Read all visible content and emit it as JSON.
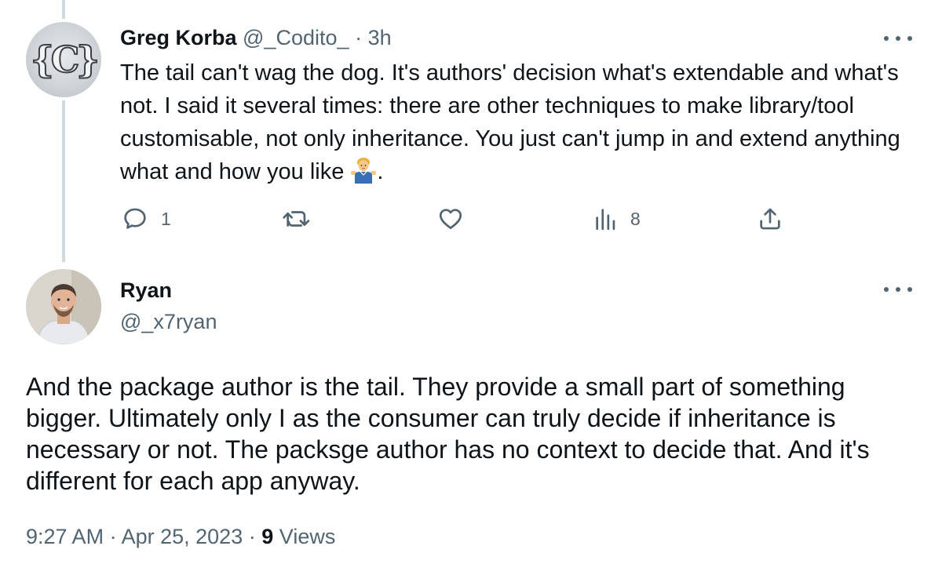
{
  "tweets": [
    {
      "author_name": "Greg Korba",
      "handle": "@_Codito_",
      "separator": "·",
      "time_ago": "3h",
      "avatar_text": "{C}",
      "text": "The tail can't wag the dog. It's authors' decision what's extendable and what's not. I said it several times: there are other techniques to make library/tool customisable, not only inheritance. You just can't jump in and extend anything what and how you like",
      "text_end": ".",
      "emoji": "man-shrugging-emoji",
      "actions": {
        "reply_count": "1",
        "retweet_count": "",
        "like_count": "",
        "views_count": "8"
      }
    },
    {
      "author_name": "Ryan",
      "handle": "@_x7ryan",
      "text": "And the package author is the tail. They provide a small part of something bigger. Ultimately only I as the consumer can truly decide if inheritance is necessary or not. The packsge author has no context to decide that. And it's different for each app anyway.",
      "time": "9:27 AM",
      "separator": "·",
      "date": "Apr 25, 2023",
      "views_count": "9",
      "views_label": "Views"
    }
  ],
  "icons": {
    "reply": "reply-icon",
    "retweet": "retweet-icon",
    "like": "heart-icon",
    "views": "views-chart-icon",
    "share": "share-icon",
    "more": "more-icon"
  },
  "colors": {
    "text_primary": "#0f1419",
    "text_secondary": "#536471",
    "thread_line": "#cfd9de"
  }
}
